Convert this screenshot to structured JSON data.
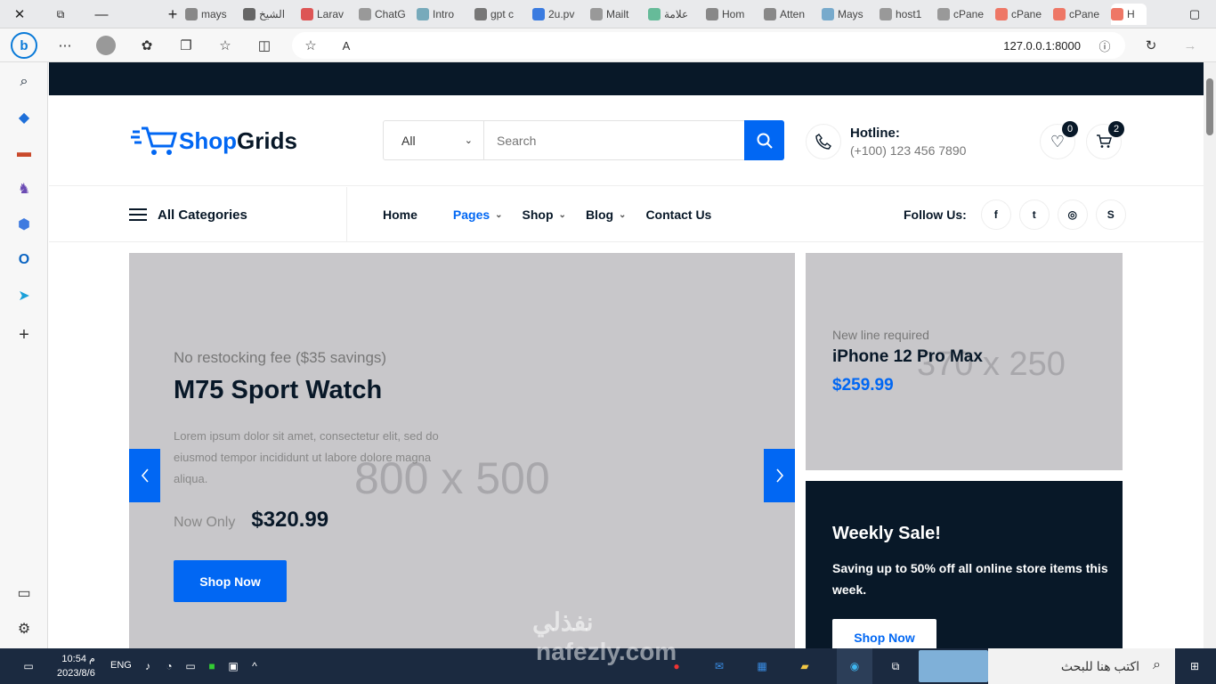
{
  "browser": {
    "tabs": [
      "mays",
      "الشيخ",
      "Larav",
      "ChatG",
      "Intro",
      "gpt c",
      "2u.pv",
      "Mailt",
      "علامة",
      "Hom",
      "Atten",
      "Mays",
      "host1",
      "cPane",
      "cPane",
      "cPane",
      "H"
    ],
    "url": "127.0.0.1:8000"
  },
  "site": {
    "logo_shop": "Shop",
    "logo_grids": "Grids",
    "search_category": "All",
    "search_placeholder": "Search",
    "hotline_label": "Hotline:",
    "hotline_number": "(+100) 123 456 7890",
    "wishlist_count": "0",
    "cart_count": "2",
    "all_categories": "All Categories",
    "menu": [
      {
        "label": "Home"
      },
      {
        "label": "Pages"
      },
      {
        "label": "Shop"
      },
      {
        "label": "Blog"
      },
      {
        "label": "Contact Us"
      }
    ],
    "follow_label": "Follow Us:"
  },
  "hero": {
    "subtitle": "No restocking fee ($35 savings)",
    "title": "M75 Sport Watch",
    "description": "Lorem ipsum dolor sit amet, consectetur elit, sed do eiusmod tempor incididunt ut labore dolore magna aliqua.",
    "now_label": "Now Only",
    "price": "$320.99",
    "button": "Shop Now",
    "placeholder": "800 x 500"
  },
  "promo1": {
    "placeholder": "370 x 250",
    "note": "New line required",
    "name": "iPhone 12 Pro Max",
    "price": "$259.99"
  },
  "promo2": {
    "title": "Weekly Sale!",
    "description": "Saving up to 50% off all online store items this week.",
    "button": "Shop Now"
  },
  "taskbar": {
    "time": "10:54 م",
    "date": "2023/8/6",
    "lang": "ENG",
    "search_text": "اكتب هنا للبحث"
  },
  "watermark": {
    "arabic": "نفذلي",
    "latin": "nafezly.com"
  },
  "colors": {
    "primary": "#0167f3",
    "dark": "#081828",
    "placeholder_bg": "#c8c7ca"
  }
}
